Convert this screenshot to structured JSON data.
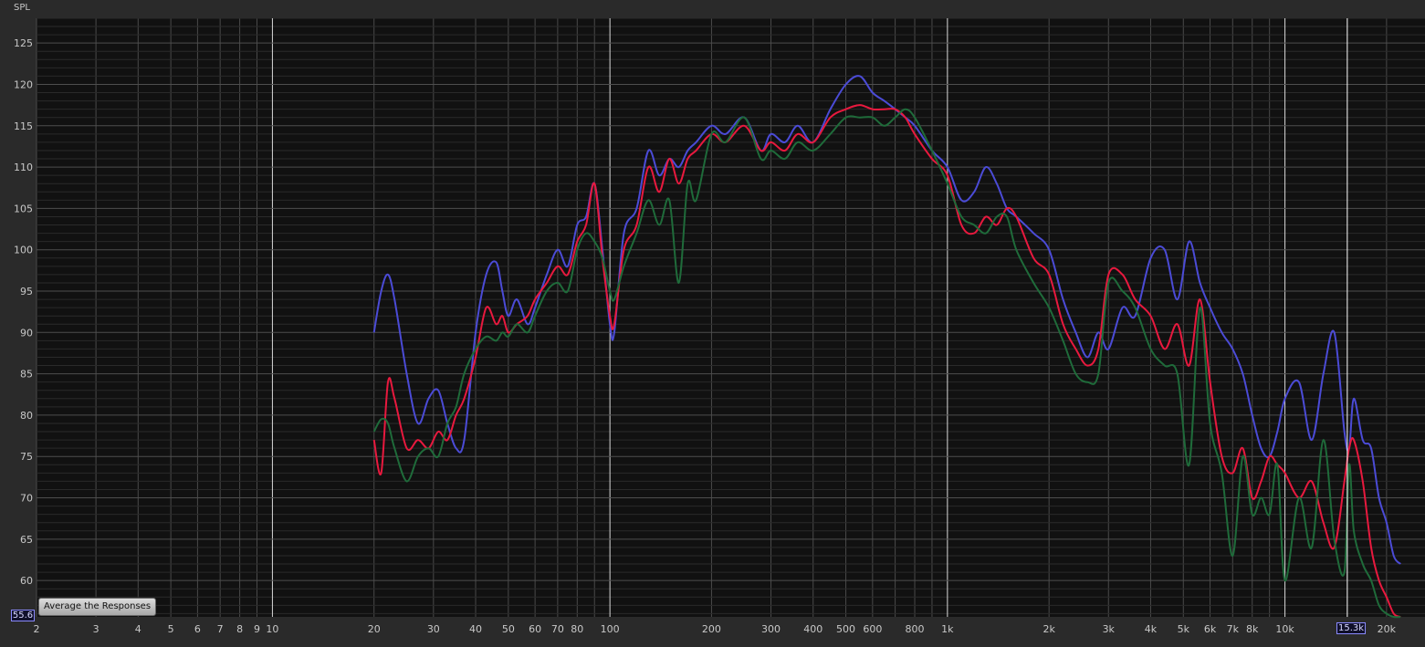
{
  "y_readout": "55.6",
  "x_readout": "15.3k",
  "average_button_label": "Average the Responses",
  "chart_data": {
    "type": "line",
    "ylabel": "SPL",
    "xscale": "log",
    "xlim": [
      2,
      26000
    ],
    "ylim": [
      55.6,
      128
    ],
    "grid": true,
    "yticks": [
      60,
      65,
      70,
      75,
      80,
      85,
      90,
      95,
      100,
      105,
      110,
      115,
      120,
      125
    ],
    "xticks": [
      {
        "v": 2,
        "label": "2"
      },
      {
        "v": 3,
        "label": "3"
      },
      {
        "v": 4,
        "label": "4"
      },
      {
        "v": 5,
        "label": "5"
      },
      {
        "v": 6,
        "label": "6"
      },
      {
        "v": 7,
        "label": "7"
      },
      {
        "v": 8,
        "label": "8"
      },
      {
        "v": 9,
        "label": "9"
      },
      {
        "v": 10,
        "label": "10"
      },
      {
        "v": 20,
        "label": "20"
      },
      {
        "v": 30,
        "label": "30"
      },
      {
        "v": 40,
        "label": "40"
      },
      {
        "v": 50,
        "label": "50"
      },
      {
        "v": 60,
        "label": "60"
      },
      {
        "v": 70,
        "label": "70"
      },
      {
        "v": 80,
        "label": "80"
      },
      {
        "v": 100,
        "label": "100"
      },
      {
        "v": 200,
        "label": "200"
      },
      {
        "v": 300,
        "label": "300"
      },
      {
        "v": 400,
        "label": "400"
      },
      {
        "v": 500,
        "label": "500"
      },
      {
        "v": 600,
        "label": "600"
      },
      {
        "v": 800,
        "label": "800"
      },
      {
        "v": 1000,
        "label": "1k"
      },
      {
        "v": 2000,
        "label": "2k"
      },
      {
        "v": 3000,
        "label": "3k"
      },
      {
        "v": 4000,
        "label": "4k"
      },
      {
        "v": 5000,
        "label": "5k"
      },
      {
        "v": 6000,
        "label": "6k"
      },
      {
        "v": 7000,
        "label": "7k"
      },
      {
        "v": 8000,
        "label": "8k"
      },
      {
        "v": 10000,
        "label": "10k"
      },
      {
        "v": 20000,
        "label": "20k"
      }
    ],
    "cursor_x": 15300,
    "series": [
      {
        "color": "#4b4bd6",
        "x": [
          20,
          21,
          22,
          23,
          25,
          27,
          29,
          31,
          33,
          35,
          37,
          40,
          43,
          46,
          48,
          50,
          53,
          57,
          60,
          65,
          70,
          75,
          80,
          85,
          90,
          95,
          100,
          103,
          110,
          120,
          130,
          140,
          150,
          160,
          170,
          180,
          200,
          220,
          250,
          280,
          300,
          330,
          360,
          400,
          450,
          500,
          550,
          600,
          650,
          700,
          750,
          800,
          900,
          1000,
          1100,
          1200,
          1300,
          1400,
          1500,
          1600,
          1800,
          2000,
          2200,
          2400,
          2600,
          2800,
          3000,
          3300,
          3600,
          4000,
          4400,
          4800,
          5200,
          5600,
          6000,
          6500,
          7000,
          7500,
          8000,
          8500,
          9000,
          9500,
          10000,
          11000,
          12000,
          13000,
          14000,
          15000,
          15500,
          16000,
          17000,
          18000,
          19000,
          20000,
          21000,
          22000
        ],
        "y": [
          90,
          95,
          97,
          94,
          85,
          79,
          82,
          83,
          79,
          76,
          77,
          90,
          97,
          98.5,
          95,
          92,
          94,
          91,
          93,
          97,
          100,
          98,
          103,
          104,
          108,
          100,
          91,
          90,
          102,
          105,
          112,
          109,
          111,
          110,
          112,
          113,
          115,
          114,
          116,
          112,
          114,
          113,
          115,
          113,
          117,
          120,
          121,
          119,
          118,
          117,
          116,
          115,
          112,
          110,
          106,
          107,
          110,
          108,
          105,
          104,
          102,
          100,
          94,
          90,
          87,
          90,
          88,
          93,
          92,
          99,
          100,
          94,
          101,
          96,
          93,
          90,
          88,
          85,
          80,
          76,
          75,
          78,
          82,
          84,
          77,
          85,
          90,
          78,
          76,
          82,
          77,
          76,
          70,
          67,
          63,
          62
        ]
      },
      {
        "color": "#e8193e",
        "x": [
          20,
          21,
          22,
          23,
          25,
          27,
          29,
          31,
          33,
          35,
          37,
          40,
          43,
          46,
          48,
          50,
          53,
          57,
          60,
          65,
          70,
          75,
          80,
          85,
          90,
          95,
          100,
          103,
          110,
          120,
          130,
          140,
          150,
          160,
          170,
          180,
          200,
          220,
          250,
          280,
          300,
          330,
          360,
          400,
          450,
          500,
          550,
          600,
          650,
          700,
          750,
          800,
          900,
          1000,
          1100,
          1200,
          1300,
          1400,
          1500,
          1600,
          1800,
          2000,
          2200,
          2400,
          2600,
          2800,
          3000,
          3300,
          3600,
          4000,
          4400,
          4800,
          5200,
          5600,
          6000,
          6500,
          7000,
          7500,
          8000,
          8500,
          9000,
          9500,
          10000,
          11000,
          12000,
          13000,
          14000,
          15000,
          15500,
          16000,
          17000,
          18000,
          19000,
          20000,
          21000,
          22000
        ],
        "y": [
          77,
          73,
          84,
          82,
          76,
          77,
          76,
          78,
          77,
          80,
          82,
          87,
          93,
          91,
          92,
          90,
          91,
          92,
          94,
          96,
          98,
          97,
          101,
          103,
          108,
          99,
          92,
          91,
          100,
          103,
          110,
          107,
          111,
          108,
          111,
          112,
          114,
          113,
          115,
          112,
          113,
          112,
          114,
          113,
          116,
          117,
          117.5,
          117,
          117,
          117,
          116,
          114,
          111,
          109,
          103,
          102,
          104,
          103,
          105,
          104,
          99,
          97,
          91,
          88,
          86,
          88,
          97,
          97,
          94,
          92,
          88,
          91,
          86,
          94,
          84,
          75,
          73,
          76,
          70,
          72,
          75,
          74,
          73,
          70,
          72,
          67,
          64,
          72,
          76,
          77,
          72,
          64,
          60,
          58,
          56,
          55.6
        ]
      },
      {
        "color": "#1f6b3a",
        "x": [
          20,
          21,
          22,
          23,
          25,
          27,
          29,
          31,
          33,
          35,
          37,
          40,
          43,
          46,
          48,
          50,
          53,
          57,
          60,
          65,
          70,
          75,
          80,
          85,
          90,
          95,
          100,
          103,
          110,
          120,
          130,
          140,
          150,
          160,
          170,
          180,
          200,
          220,
          250,
          280,
          300,
          330,
          360,
          400,
          450,
          500,
          550,
          600,
          650,
          700,
          750,
          800,
          900,
          1000,
          1100,
          1200,
          1300,
          1400,
          1500,
          1600,
          1800,
          2000,
          2200,
          2400,
          2600,
          2800,
          3000,
          3300,
          3600,
          4000,
          4400,
          4800,
          5200,
          5600,
          6000,
          6500,
          7000,
          7500,
          8000,
          8500,
          9000,
          9500,
          10000,
          11000,
          12000,
          13000,
          14000,
          15000,
          15500,
          16000,
          17000,
          18000,
          19000,
          20000,
          21000,
          22000
        ],
        "y": [
          78,
          79.5,
          79,
          76,
          72,
          75,
          76,
          75,
          79,
          81,
          85,
          88,
          89.5,
          89,
          90,
          89.5,
          91,
          90,
          92,
          95,
          96,
          95,
          100,
          102,
          101,
          99,
          95,
          94,
          98,
          102,
          106,
          103,
          106,
          96,
          108,
          106,
          114,
          113,
          116,
          111,
          112,
          111,
          113,
          112,
          114,
          116,
          116,
          116,
          115,
          116,
          117,
          116,
          112,
          108,
          104,
          103,
          102,
          104,
          104,
          100,
          96,
          93,
          89,
          85,
          84,
          85,
          96,
          95,
          93,
          88,
          86,
          85,
          74,
          93,
          79,
          73,
          63,
          75,
          68,
          70,
          68,
          74,
          60,
          70,
          64,
          77,
          65,
          61,
          74,
          66,
          62,
          60,
          57,
          56,
          55.6,
          55.6
        ]
      }
    ]
  }
}
